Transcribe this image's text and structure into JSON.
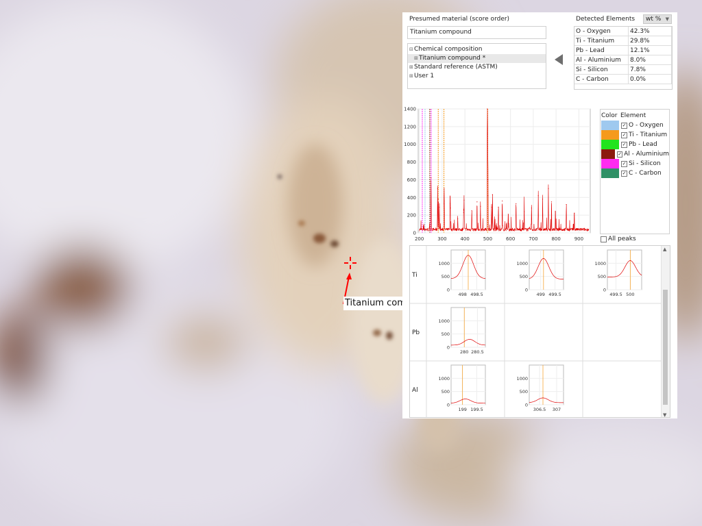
{
  "colors": {
    "oxygen": "#9fc9ef",
    "titanium": "#f59a1c",
    "lead": "#22e41e",
    "aluminium": "#8b1a0e",
    "silicon": "#ff2cf0",
    "carbon": "#2f9166",
    "spectrum": "#e00000",
    "marker": "#ff0000"
  },
  "image_label": "Titanium compound",
  "presumed": {
    "header": "Presumed material (score order)",
    "value": "Titanium compound",
    "tree": [
      {
        "label": "Chemical composition",
        "expander": "minus",
        "indent": 0,
        "selected": false
      },
      {
        "label": "Titanium compound *",
        "expander": "plus",
        "indent": 1,
        "selected": true
      },
      {
        "label": "Standard reference (ASTM)",
        "expander": "plus",
        "indent": 0,
        "selected": false
      },
      {
        "label": "User 1",
        "expander": "plus",
        "indent": 0,
        "selected": false
      }
    ]
  },
  "detected": {
    "header": "Detected Elements",
    "unit": "wt %",
    "rows": [
      {
        "element": "O - Oxygen",
        "value": "42.3%"
      },
      {
        "element": "Ti - Titanium",
        "value": "29.8%"
      },
      {
        "element": "Pb - Lead",
        "value": "12.1%"
      },
      {
        "element": "Al - Aluminium",
        "value": "8.0%"
      },
      {
        "element": "Si - Silicon",
        "value": "7.8%"
      },
      {
        "element": "C - Carbon",
        "value": "0.0%"
      }
    ]
  },
  "legend": {
    "col_color": "Color",
    "col_element": "Element",
    "rows": [
      {
        "label": "O - Oxygen",
        "color": "#9fc9ef",
        "checked": true
      },
      {
        "label": "Ti - Titanium",
        "color": "#f59a1c",
        "checked": true
      },
      {
        "label": "Pb - Lead",
        "color": "#22e41e",
        "checked": true
      },
      {
        "label": "Al - Aluminium",
        "color": "#8b1a0e",
        "checked": true
      },
      {
        "label": "Si - Silicon",
        "color": "#ff2cf0",
        "checked": true
      },
      {
        "label": "C - Carbon",
        "color": "#2f9166",
        "checked": true
      }
    ],
    "all_peaks": "All peaks"
  },
  "chart_data": {
    "type": "line",
    "xlim": [
      195,
      950
    ],
    "ylim": [
      0,
      1400
    ],
    "x_ticks": [
      "200",
      "300",
      "400",
      "500",
      "600",
      "700",
      "800",
      "900"
    ],
    "y_ticks": [
      "0",
      "200",
      "400",
      "600",
      "800",
      "1000",
      "1200",
      "1400"
    ],
    "grid": true,
    "element_lines": [
      {
        "x": 213,
        "color": "#ff2cf0"
      },
      {
        "x": 225,
        "color": "#9fc9ef"
      },
      {
        "x": 246,
        "color": "#8b1a0e"
      },
      {
        "x": 252,
        "color": "#ff2cf0"
      },
      {
        "x": 283,
        "color": "#f59a1c"
      },
      {
        "x": 308,
        "color": "#f59a1c"
      },
      {
        "x": 500,
        "color": "#f59a1c"
      }
    ],
    "peaks": [
      [
        498.5,
        1400
      ],
      [
        499.1,
        1120
      ],
      [
        500.7,
        600
      ],
      [
        501.4,
        420
      ],
      [
        521,
        430
      ],
      [
        547,
        290
      ],
      [
        280.2,
        500
      ],
      [
        283.3,
        380
      ],
      [
        251.6,
        620
      ],
      [
        288.2,
        290
      ],
      [
        308.2,
        330
      ],
      [
        309.3,
        360
      ],
      [
        396.2,
        370
      ],
      [
        394.4,
        230
      ],
      [
        334.9,
        330
      ],
      [
        336.1,
        280
      ],
      [
        368.5,
        160
      ],
      [
        430.1,
        250
      ],
      [
        453.3,
        350
      ],
      [
        468.2,
        300
      ],
      [
        516.7,
        290
      ],
      [
        564.0,
        360
      ],
      [
        590.2,
        210
      ],
      [
        624.3,
        330
      ],
      [
        660.0,
        240
      ],
      [
        692.5,
        280
      ],
      [
        722.0,
        420
      ],
      [
        741.0,
        380
      ],
      [
        766.2,
        500
      ],
      [
        780.0,
        350
      ],
      [
        797.1,
        240
      ],
      [
        845.0,
        320
      ],
      [
        880.0,
        220
      ]
    ]
  },
  "peak_grid": {
    "rows": [
      {
        "label": "Ti",
        "plots": [
          {
            "xlim": [
              497.6,
              498.8
            ],
            "ticks": [
              "498",
              "498.5"
            ],
            "tick_values": [
              498,
              498.5
            ],
            "peak": 498.2,
            "peak_y": 1300,
            "base": 420,
            "marker": 498.2
          },
          {
            "xlim": [
              498.6,
              499.8
            ],
            "ticks": [
              "499",
              "499.5"
            ],
            "tick_values": [
              499,
              499.5
            ],
            "peak": 499.1,
            "peak_y": 1180,
            "base": 400,
            "marker": 499.1
          },
          {
            "xlim": [
              499.2,
              500.4
            ],
            "ticks": [
              "499.5",
              "500"
            ],
            "tick_values": [
              499.5,
              500
            ],
            "peak": 500.0,
            "peak_y": 1100,
            "base": 480,
            "marker": 500.0
          }
        ]
      },
      {
        "label": "Pb",
        "plots": [
          {
            "xlim": [
              279.5,
              280.8
            ],
            "ticks": [
              "280",
              "280.5"
            ],
            "tick_values": [
              280,
              280.5
            ],
            "peak": 280.2,
            "peak_y": 300,
            "base": 80,
            "marker": 280.0
          }
        ]
      },
      {
        "label": "Al",
        "plots": [
          {
            "xlim": [
              198.6,
              199.8
            ],
            "ticks": [
              "199",
              "199.5"
            ],
            "tick_values": [
              199,
              199.5
            ],
            "peak": 199.1,
            "peak_y": 220,
            "base": 60,
            "marker": 199.0
          },
          {
            "xlim": [
              306.2,
              307.2
            ],
            "ticks": [
              "306.5",
              "307"
            ],
            "tick_values": [
              306.5,
              307
            ],
            "peak": 306.6,
            "peak_y": 260,
            "base": 80,
            "marker": 306.6
          }
        ]
      }
    ],
    "y_ticks": [
      "0",
      "500",
      "1000"
    ],
    "ylim": [
      0,
      1500
    ]
  }
}
